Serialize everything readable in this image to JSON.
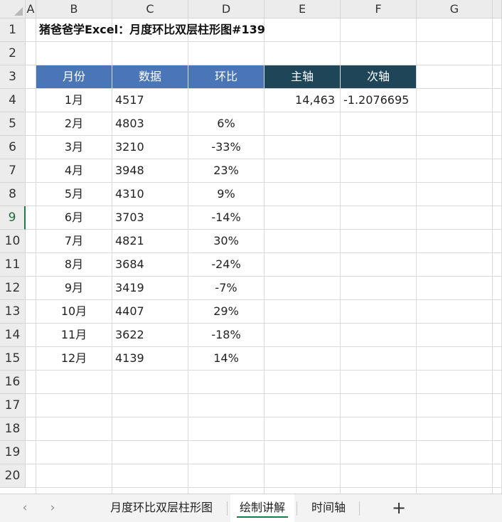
{
  "column_headers": [
    "A",
    "B",
    "C",
    "D",
    "E",
    "F",
    "G"
  ],
  "row_numbers": [
    "1",
    "2",
    "3",
    "4",
    "5",
    "6",
    "7",
    "8",
    "9",
    "10",
    "11",
    "12",
    "13",
    "14",
    "15",
    "16",
    "17",
    "18",
    "19",
    "20"
  ],
  "active_row": "9",
  "title": "猪爸爸学Excel：月度环比双层柱形图#139",
  "table": {
    "headers": {
      "month": "月份",
      "data": "数据",
      "mom": "环比",
      "primary_axis": "主轴",
      "secondary_axis": "次轴"
    },
    "rows": [
      {
        "month": "1月",
        "data": "4517",
        "mom": ""
      },
      {
        "month": "2月",
        "data": "4803",
        "mom": "6%"
      },
      {
        "month": "3月",
        "data": "3210",
        "mom": "-33%"
      },
      {
        "month": "4月",
        "data": "3948",
        "mom": "23%"
      },
      {
        "month": "5月",
        "data": "4310",
        "mom": "9%"
      },
      {
        "month": "6月",
        "data": "3703",
        "mom": "-14%"
      },
      {
        "month": "7月",
        "data": "4821",
        "mom": "30%"
      },
      {
        "month": "8月",
        "data": "3684",
        "mom": "-24%"
      },
      {
        "month": "9月",
        "data": "3419",
        "mom": "-7%"
      },
      {
        "month": "10月",
        "data": "4407",
        "mom": "29%"
      },
      {
        "month": "11月",
        "data": "3622",
        "mom": "-18%"
      },
      {
        "month": "12月",
        "data": "4139",
        "mom": "14%"
      }
    ],
    "primary_axis_value": "14,463",
    "secondary_axis_value": "-1.2076695"
  },
  "sheet_tabs": [
    {
      "label": "月度环比双层柱形图",
      "active": false
    },
    {
      "label": "绘制讲解",
      "active": true
    },
    {
      "label": "时间轴",
      "active": false
    }
  ],
  "add_sheet_label": "+",
  "nav_prev_label": "‹",
  "nav_next_label": "›",
  "colors": {
    "header_blue": "#4a76b8",
    "header_dark": "#1f4658",
    "active_accent": "#1e7a45"
  }
}
